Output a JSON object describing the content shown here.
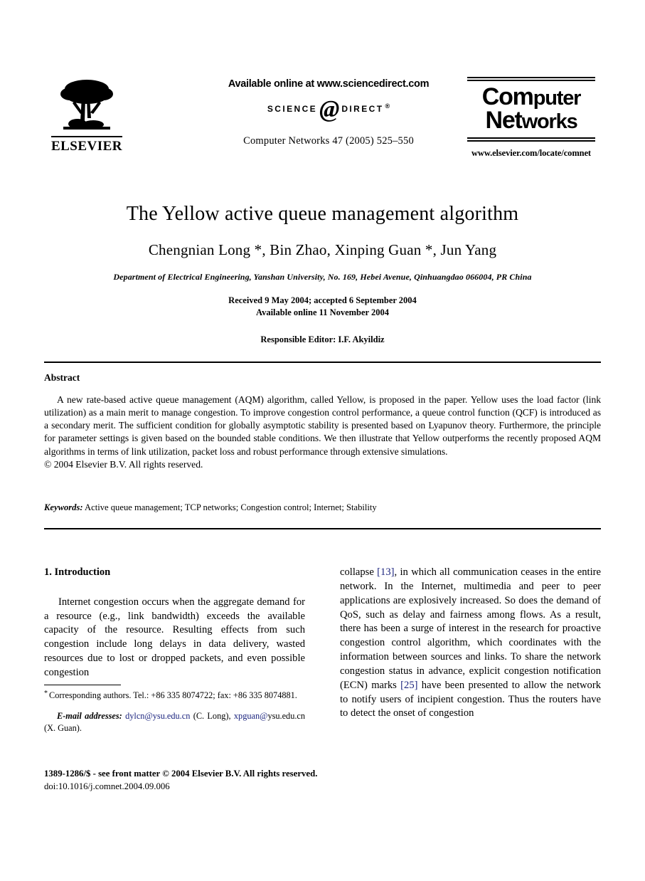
{
  "masthead": {
    "publisher_name": "ELSEVIER",
    "publisher_logo_icon": "elsevier-tree-logo",
    "available_online": "Available online at www.sciencedirect.com",
    "sciencedirect_left": "Science",
    "sciencedirect_at": "@",
    "sciencedirect_right": "Direct",
    "sciencedirect_reg": "®",
    "journal_citation": "Computer Networks 47 (2005) 525–550",
    "journal_logo_line1_a": "C",
    "journal_logo_line1_b": "om",
    "journal_logo_line1_c": "puter",
    "journal_logo_line2_a": "N",
    "journal_logo_line2_b": "et",
    "journal_logo_line2_c": "works",
    "journal_url": "www.elsevier.com/locate/comnet"
  },
  "article": {
    "title": "The Yellow active queue management algorithm",
    "authors": "Chengnian Long *, Bin Zhao, Xinping Guan *, Jun Yang",
    "affiliation": "Department of Electrical Engineering, Yanshan University, No. 169, Hebei Avenue, Qinhuangdao 066004, PR China",
    "received_line": "Received 9 May 2004; accepted 6 September 2004",
    "available_line": "Available online 11 November 2004",
    "editor_line": "Responsible Editor: I.F. Akyildiz"
  },
  "abstract": {
    "heading": "Abstract",
    "body": "A new rate-based active queue management (AQM) algorithm, called Yellow, is proposed in the paper. Yellow uses the load factor (link utilization) as a main merit to manage congestion. To improve congestion control performance, a queue control function (QCF) is introduced as a secondary merit. The sufficient condition for globally asymptotic stability is presented based on Lyapunov theory. Furthermore, the principle for parameter settings is given based on the bounded stable conditions. We then illustrate that Yellow outperforms the recently proposed AQM algorithms in terms of link utilization, packet loss and robust performance through extensive simulations.",
    "copyright": "© 2004 Elsevier B.V. All rights reserved.",
    "keywords_label": "Keywords:",
    "keywords_value": "Active queue management; TCP networks; Congestion control; Internet; Stability"
  },
  "body": {
    "section_heading": "1. Introduction",
    "left_paragraph": "Internet congestion occurs when the aggregate demand for a resource (e.g., link bandwidth) exceeds the available capacity of the resource. Resulting effects from such congestion include long delays in data delivery, wasted resources due to lost or dropped packets, and even possible congestion",
    "right_part1": "collapse ",
    "right_cite1": "[13]",
    "right_part2": ", in which all communication ceases in the entire network. In the Internet, multimedia and peer to peer applications are explosively increased. So does the demand of QoS, such as delay and fairness among flows. As a result, there has been a surge of interest in the research for proactive congestion control algorithm, which coordinates with the information between sources and links. To share the network congestion status in advance, explicit congestion notification (ECN) marks ",
    "right_cite2": "[25]",
    "right_part3": " have been presented to allow the network to notify users of incipient congestion. Thus the routers have to detect the onset of congestion"
  },
  "footnotes": {
    "corresponding_mark": "*",
    "corresponding_text": "Corresponding authors. Tel.: +86 335 8074722; fax: +86 335 8074881.",
    "email_label": "E-mail addresses:",
    "email_1": "dylcn@ysu.edu.cn",
    "email_1_owner": "(C. Long),",
    "email_2": "xpguan@",
    "email_2_cont": "ysu.edu.cn",
    "email_2_owner": "(X. Guan)."
  },
  "footer": {
    "issn_line": "1389-1286/$ - see front matter © 2004 Elsevier B.V. All rights reserved.",
    "doi_line": "doi:10.1016/j.comnet.2004.09.006"
  },
  "colors": {
    "link": "#1a237e",
    "text": "#000000",
    "background": "#ffffff"
  }
}
